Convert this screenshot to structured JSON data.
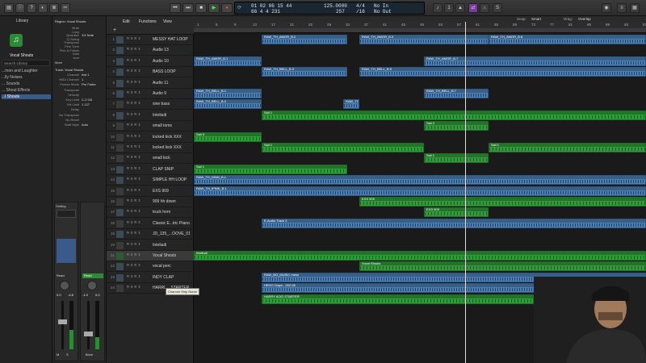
{
  "library": {
    "title": "Library",
    "patch": "Vocal Shouts",
    "search_placeholder": "Search Library",
    "items": [
      "...mon and Laughter",
      "...lly Noises",
      "... Sounds",
      "... Shout Effects",
      "...l Shouts"
    ]
  },
  "inspector": {
    "region_label": "Region: Vocal Shouts",
    "more": "More",
    "track_label": "Track: Vocal Shouts",
    "params": [
      [
        "Mute",
        ""
      ],
      [
        "Loop",
        ""
      ],
      [
        "Quantize",
        "1/4 Note"
      ],
      [
        "Q-Swing",
        ""
      ],
      [
        "Transpose",
        ""
      ],
      [
        "Fine Tune",
        ""
      ],
      [
        "Flex & Follow",
        ""
      ],
      [
        "Gain",
        ""
      ],
      [
        "Icon",
        ""
      ],
      [
        "Channel",
        "Inst 1"
      ],
      [
        "MIDI Channel",
        "1"
      ],
      [
        "Freeze Mode",
        "Pre Fader"
      ],
      [
        "Transpose",
        ""
      ],
      [
        "Velocity",
        ""
      ],
      [
        "Key Limit",
        "C-2 G8"
      ],
      [
        "Vel Limit",
        "1 127"
      ],
      [
        "Delay",
        ""
      ],
      [
        "No Transpose",
        ""
      ],
      [
        "No Reset",
        ""
      ],
      [
        "Staff Style",
        "Auto"
      ]
    ],
    "channel_strip": {
      "name1": "Vocal Shou...",
      "name2": "Stereo Out",
      "setting": "Setting",
      "eq": "EQ",
      "button_read": "Read",
      "vol1": "0.0",
      "vol2": "-1.0",
      "pan1": "-4.8",
      "pan2": "0.0",
      "bottom1": "M",
      "bottom2": "S",
      "bounce": "Bnce"
    }
  },
  "toolbar": {
    "transport": {
      "rewind": "⏮",
      "ffwd": "⏭",
      "stop": "■",
      "play": "▶",
      "record": "●",
      "cycle": "⟳"
    },
    "menus": [
      "Edit",
      "Functions",
      "View"
    ],
    "snap_label": "Snap:",
    "snap_value": "Smart",
    "drag_label": "Drag:",
    "drag_value": "Overlap"
  },
  "lcd": {
    "position": "01 02 06 15 44",
    "bars": "66 4 4 231",
    "tempo": "125.0000",
    "sig": "4/4",
    "sig2": "/16",
    "in": "No In",
    "out": "No Out",
    "beats": "257",
    "cpu": ""
  },
  "ruler": {
    "bars": [
      "1",
      "5",
      "9",
      "13",
      "17",
      "21",
      "25",
      "29",
      "33",
      "37",
      "41",
      "45",
      "49",
      "53",
      "57",
      "61",
      "65",
      "69",
      "73",
      "77",
      "81",
      "85",
      "89",
      "93",
      "97"
    ]
  },
  "tracks": [
    {
      "num": "1",
      "name": "MESSY HAT LOOP"
    },
    {
      "num": "2",
      "name": "Audio 13"
    },
    {
      "num": "3",
      "name": "Audio 10"
    },
    {
      "num": "4",
      "name": "BASS LOOP"
    },
    {
      "num": "5",
      "name": "Audio 11"
    },
    {
      "num": "6",
      "name": "Audio 9"
    },
    {
      "num": "7",
      "name": "sine bass"
    },
    {
      "num": "8",
      "name": "Inteliudi"
    },
    {
      "num": "9",
      "name": "small toms"
    },
    {
      "num": "10",
      "name": "locked kick XXX"
    },
    {
      "num": "11",
      "name": "locked kick XXX"
    },
    {
      "num": "12",
      "name": "small kick"
    },
    {
      "num": "13",
      "name": "CLAP SNIP"
    },
    {
      "num": "14",
      "name": "SIMPLE HH LOOP"
    },
    {
      "num": "15",
      "name": "EXS 909"
    },
    {
      "num": "16",
      "name": "909 hh down"
    },
    {
      "num": "17",
      "name": "truck horn"
    },
    {
      "num": "18",
      "name": "Classic E...tric Piano"
    },
    {
      "num": "19",
      "name": "JD_135_...OOVE_01"
    },
    {
      "num": "20",
      "name": "Inteliudi"
    },
    {
      "num": "21",
      "name": "Vocal Shouts"
    },
    {
      "num": "22",
      "name": "vocal perc"
    },
    {
      "num": "23",
      "name": "INDY CLAP"
    },
    {
      "num": "24",
      "name": "HARRI..._STARTER"
    }
  ],
  "tooltip": "Channel Strip Name",
  "regions": [
    {
      "row": 0,
      "color": "blue",
      "label": "RAW_TH_AMOR_B.2",
      "start": 84,
      "end": 190
    },
    {
      "row": 0,
      "color": "blue",
      "label": "RAW_TH_AMOR_B.3",
      "start": 205,
      "end": 365
    },
    {
      "row": 0,
      "color": "blue",
      "label": "RAW_TH_AMOR_B.8",
      "start": 365,
      "end": 560
    },
    {
      "row": 2,
      "color": "blue",
      "label": "RAW_TH_AMOR_B.1",
      "start": 0,
      "end": 84
    },
    {
      "row": 2,
      "color": "blue",
      "label": "RAW_TH_AMOR_B.7",
      "start": 285,
      "end": 560
    },
    {
      "row": 3,
      "color": "blue",
      "label": "RAW_TH_BELL_B.3",
      "start": 84,
      "end": 190
    },
    {
      "row": 3,
      "color": "blue",
      "label": "RAW_TH_BELL_B.5",
      "start": 205,
      "end": 560
    },
    {
      "row": 5,
      "color": "blue",
      "label": "RAW_TH_BELL_B.1",
      "start": 0,
      "end": 84
    },
    {
      "row": 5,
      "color": "blue",
      "label": "RAW_TH_BELL_B.7",
      "start": 285,
      "end": 365
    },
    {
      "row": 6,
      "color": "blue",
      "label": "RAW_TH_BELL_B.2",
      "start": 0,
      "end": 84
    },
    {
      "row": 6,
      "color": "blue",
      "label": "RAW_TH_BELL_B.8",
      "start": 185,
      "end": 205
    },
    {
      "row": 7,
      "color": "green",
      "label": "Sail 1",
      "start": 84,
      "end": 560
    },
    {
      "row": 8,
      "color": "green",
      "label": "Sail 2",
      "start": 285,
      "end": 365
    },
    {
      "row": 9,
      "color": "green",
      "label": "Sail 3",
      "start": 0,
      "end": 84
    },
    {
      "row": 10,
      "color": "green",
      "label": "Sail 1",
      "start": 84,
      "end": 285
    },
    {
      "row": 10,
      "color": "green",
      "label": "Sail 1",
      "start": 365,
      "end": 560
    },
    {
      "row": 11,
      "color": "green",
      "label": "Sail 1",
      "start": 285,
      "end": 365
    },
    {
      "row": 12,
      "color": "green",
      "label": "Sail 1",
      "start": 0,
      "end": 190
    },
    {
      "row": 13,
      "color": "blue",
      "label": "RAW_TH_DINN_B.1",
      "start": 0,
      "end": 560
    },
    {
      "row": 14,
      "color": "blue",
      "label": "RAW_TH_IPINK_B.1",
      "start": 0,
      "end": 560
    },
    {
      "row": 15,
      "color": "green",
      "label": "EXS 909",
      "start": 205,
      "end": 560
    },
    {
      "row": 16,
      "color": "green",
      "label": "EXS 909",
      "start": 285,
      "end": 365
    },
    {
      "row": 17,
      "color": "blue",
      "label": "E-Audio Track 2",
      "start": 84,
      "end": 560
    },
    {
      "row": 20,
      "color": "green",
      "label": "Inteliudi",
      "start": 0,
      "end": 560
    },
    {
      "row": 21,
      "color": "green",
      "label": "Vocal Shouts",
      "start": 205,
      "end": 560
    },
    {
      "row": 22,
      "color": "blue",
      "label": "RAW_BO_MUSIC mess",
      "start": 84,
      "end": 560
    },
    {
      "row": 23,
      "color": "blue",
      "label": "HEHO Claps - 002.08",
      "start": 84,
      "end": 560
    },
    {
      "row": 24,
      "color": "green",
      "label": "HARRY ACID STARTER",
      "start": 84,
      "end": 421
    }
  ]
}
